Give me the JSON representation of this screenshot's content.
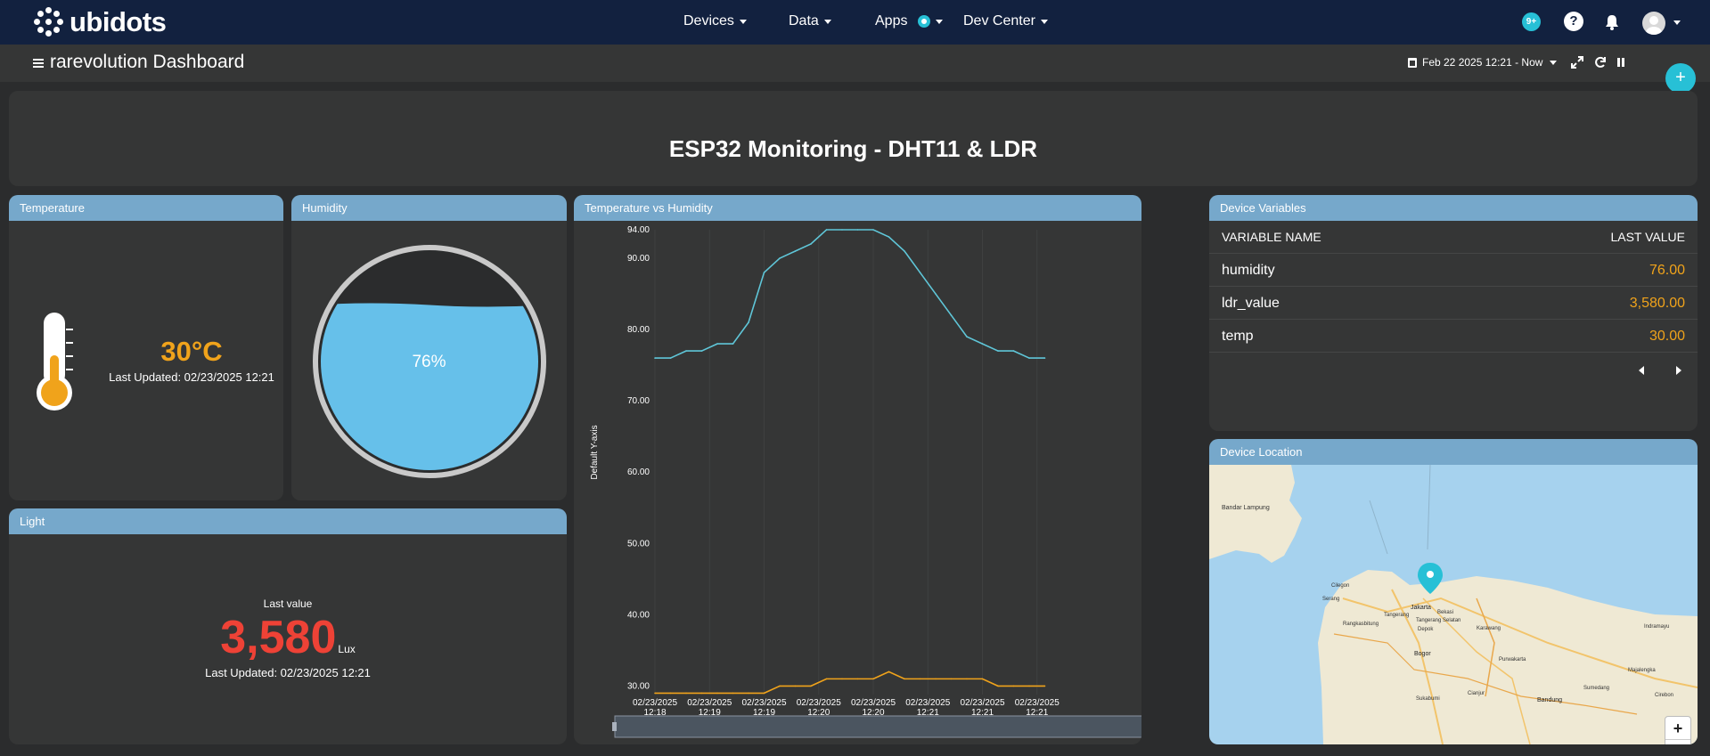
{
  "nav": {
    "brand": "ubidots",
    "menus": [
      "Devices",
      "Data",
      "Apps",
      "Dev Center"
    ],
    "notifications_badge": "9+",
    "help_label": "?"
  },
  "subheader": {
    "title": "rarevolution Dashboard",
    "date_range": "Feb 22 2025 12:21 - Now",
    "add_label": "+"
  },
  "banner": {
    "title": "ESP32 Monitoring - DHT11 & LDR"
  },
  "temperature": {
    "header": "Temperature",
    "value": "30°C",
    "updated": "Last Updated: 02/23/2025 12:21",
    "level_fraction": 0.5
  },
  "humidity": {
    "header": "Humidity",
    "value": "76%",
    "level_fraction": 0.76
  },
  "light": {
    "header": "Light",
    "label": "Last value",
    "value": "3,580",
    "unit": "Lux",
    "updated": "Last Updated: 02/23/2025 12:21"
  },
  "chart": {
    "header": "Temperature vs Humidity",
    "ylabel": "Default Y-axis"
  },
  "chart_data": {
    "type": "line",
    "ylabel": "Default Y-axis",
    "ylim": [
      28.8,
      94
    ],
    "yticks": [
      "94.00",
      "90.00",
      "80.00",
      "70.00",
      "60.00",
      "50.00",
      "40.00",
      "30.00"
    ],
    "ytick_values": [
      94,
      90,
      80,
      70,
      60,
      50,
      40,
      30
    ],
    "xlim": [
      0,
      3.0
    ],
    "xticks": [
      {
        "x": 0.0,
        "line1": "02/23/2025",
        "line2": "12:18"
      },
      {
        "x": 0.35,
        "line1": "02/23/2025",
        "line2": "12:19"
      },
      {
        "x": 0.7,
        "line1": "02/23/2025",
        "line2": "12:19"
      },
      {
        "x": 1.05,
        "line1": "02/23/2025",
        "line2": "12:20"
      },
      {
        "x": 1.4,
        "line1": "02/23/2025",
        "line2": "12:20"
      },
      {
        "x": 1.75,
        "line1": "02/23/2025",
        "line2": "12:21"
      },
      {
        "x": 2.1,
        "line1": "02/23/2025",
        "line2": "12:21"
      },
      {
        "x": 2.45,
        "line1": "02/23/2025",
        "line2": "12:21"
      }
    ],
    "series": [
      {
        "color": "#5fc6d8",
        "x": [
          0,
          0.1,
          0.2,
          0.3,
          0.4,
          0.5,
          0.6,
          0.7,
          0.8,
          0.9,
          1.0,
          1.1,
          1.2,
          1.3,
          1.4,
          1.5,
          1.6,
          1.7,
          1.8,
          1.9,
          2.0,
          2.1,
          2.2,
          2.3,
          2.4,
          2.5
        ],
        "values": [
          76,
          76,
          77,
          77,
          78,
          78,
          81,
          88,
          90,
          91,
          92,
          94,
          94,
          94,
          94,
          93,
          91,
          88,
          85,
          82,
          79,
          78,
          77,
          77,
          76,
          76
        ]
      },
      {
        "color": "#f0a31b",
        "x": [
          0,
          0.1,
          0.2,
          0.3,
          0.4,
          0.5,
          0.6,
          0.7,
          0.8,
          0.9,
          1.0,
          1.1,
          1.2,
          1.3,
          1.4,
          1.5,
          1.6,
          1.7,
          1.8,
          1.9,
          2.0,
          2.1,
          2.2,
          2.3,
          2.4,
          2.5
        ],
        "values": [
          29,
          29,
          29,
          29,
          29,
          29,
          29,
          29,
          30,
          30,
          30,
          31,
          31,
          31,
          31,
          32,
          31,
          31,
          31,
          31,
          31,
          31,
          30,
          30,
          30,
          30
        ]
      }
    ]
  },
  "variables": {
    "header": "Device Variables",
    "col_name": "VARIABLE NAME",
    "col_value": "LAST VALUE",
    "rows": [
      {
        "name": "humidity",
        "value": "76.00"
      },
      {
        "name": "ldr_value",
        "value": "3,580.00"
      },
      {
        "name": "temp",
        "value": "30.00"
      }
    ]
  },
  "map": {
    "header": "Device Location",
    "zoom_in": "+",
    "zoom_out": "−",
    "places": [
      "Bandar Lampung",
      "Cilegon",
      "Serang",
      "Jakarta",
      "Bekasi",
      "Tangerang",
      "Tangerang Selatan",
      "Depok",
      "Bogor",
      "Rangkasbitung",
      "Karawang",
      "Purwakarta",
      "Cianjur",
      "Bandung",
      "Sumedang",
      "Sukabumi",
      "Majalengka",
      "Indramayu",
      "Cirebon"
    ]
  },
  "colors": {
    "nav_bg": "#12213f",
    "card_header": "#76a8cb",
    "accent": "#27c0d6",
    "temp_orange": "#f0a31b",
    "light_red": "#ee4236",
    "humidity_blue": "#66c0ea"
  }
}
